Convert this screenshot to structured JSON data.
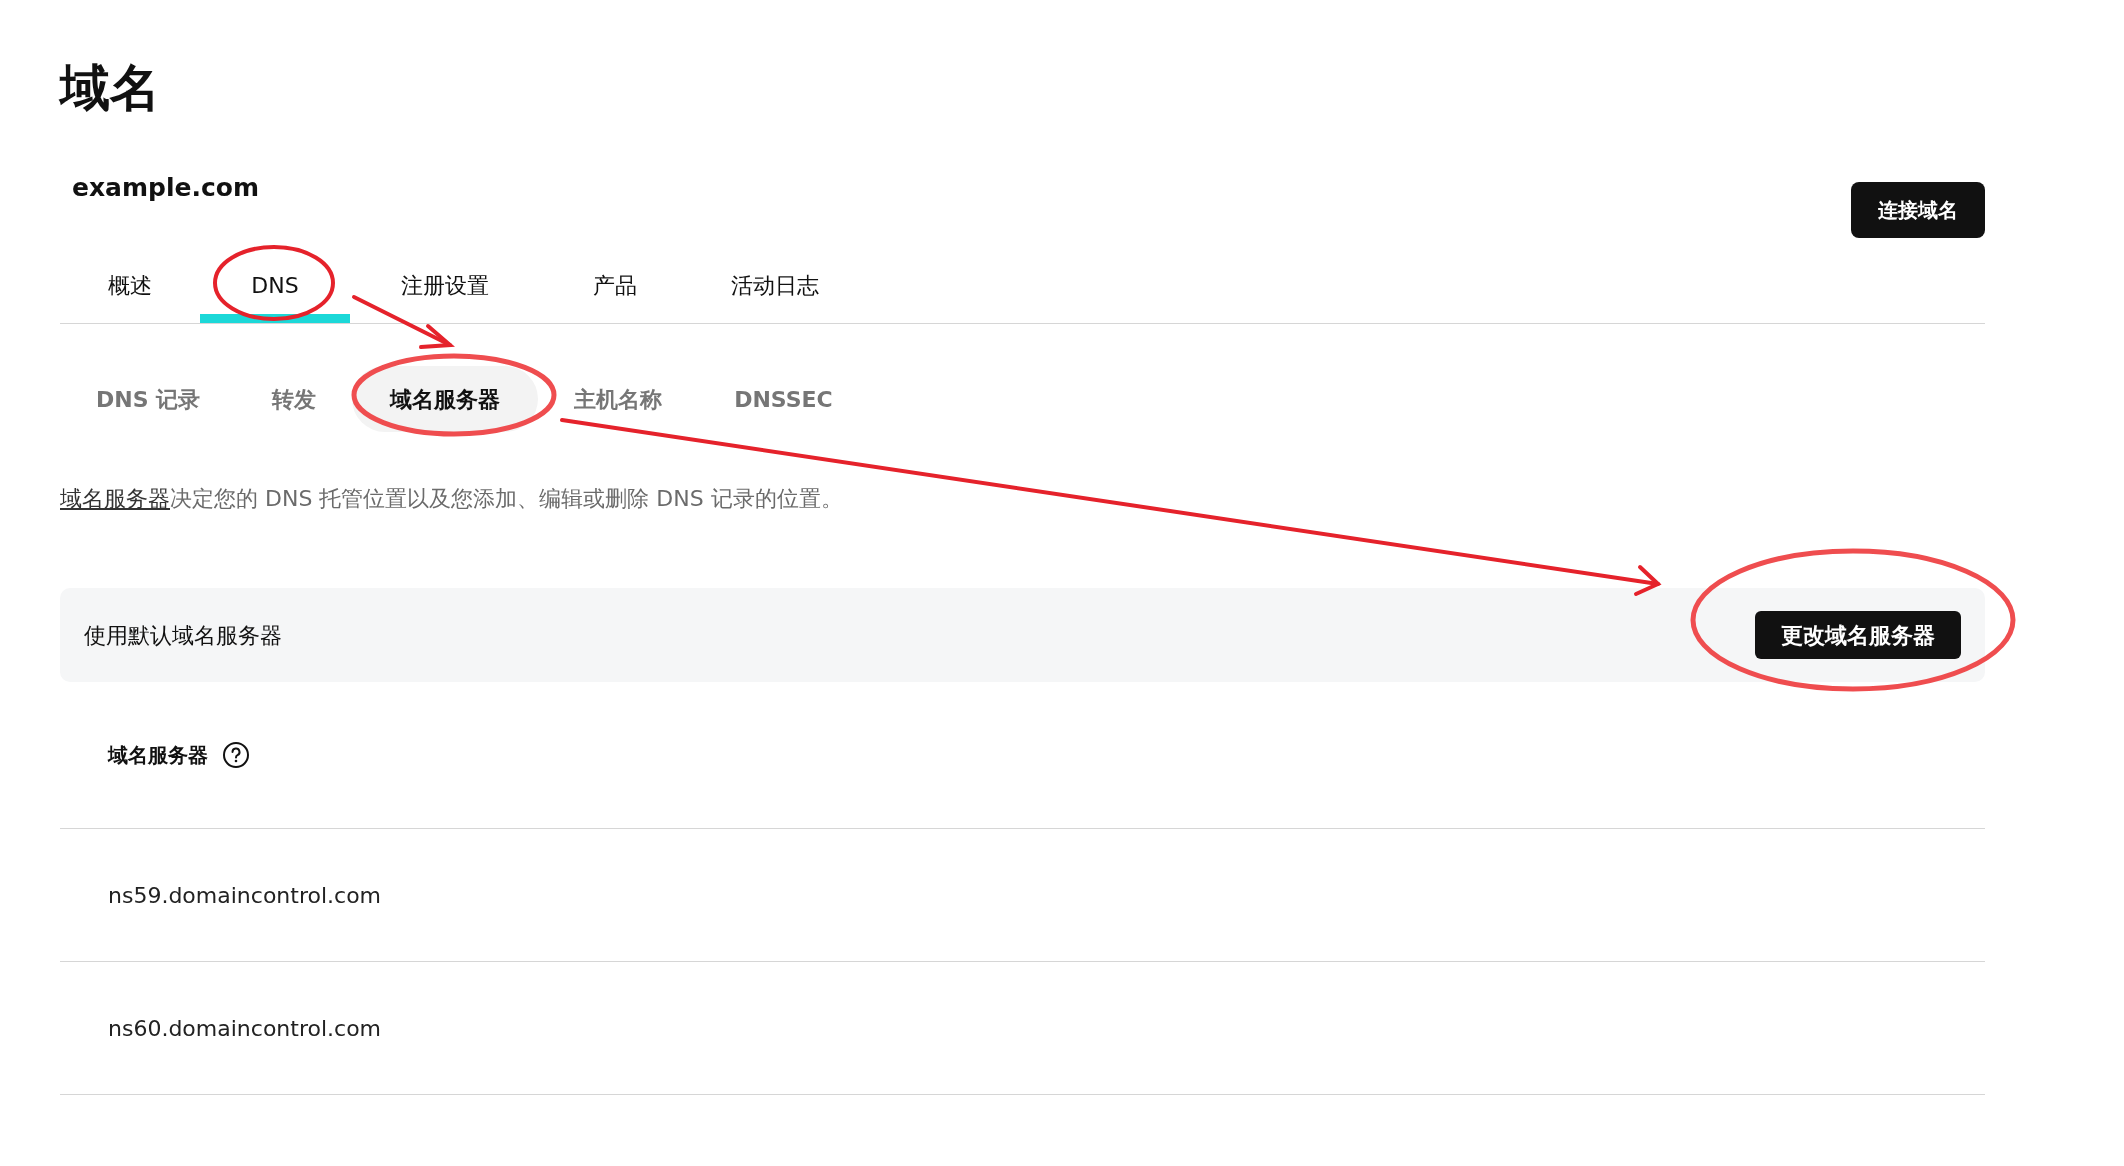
{
  "page_title": "域名",
  "domain": "example.com",
  "connect_button": "连接域名",
  "tabs": [
    {
      "label": "概述",
      "selected": false
    },
    {
      "label": "DNS",
      "selected": true
    },
    {
      "label": "注册设置",
      "selected": false
    },
    {
      "label": "产品",
      "selected": false
    },
    {
      "label": "活动日志",
      "selected": false
    }
  ],
  "sub_tabs": [
    {
      "label": "DNS 记录",
      "selected": false
    },
    {
      "label": "转发",
      "selected": false
    },
    {
      "label": "域名服务器",
      "selected": true
    },
    {
      "label": "主机名称",
      "selected": false
    },
    {
      "label": "DNSSEC",
      "selected": false
    }
  ],
  "description": {
    "link": "域名服务器",
    "text": "决定您的 DNS 托管位置以及您添加、编辑或删除 DNS 记录的位置。"
  },
  "nameserver_card": {
    "label": "使用默认域名服务器",
    "button": "更改域名服务器"
  },
  "nameservers": {
    "heading": "域名服务器",
    "rows": [
      "ns59.domaincontrol.com",
      "ns60.domaincontrol.com"
    ]
  }
}
